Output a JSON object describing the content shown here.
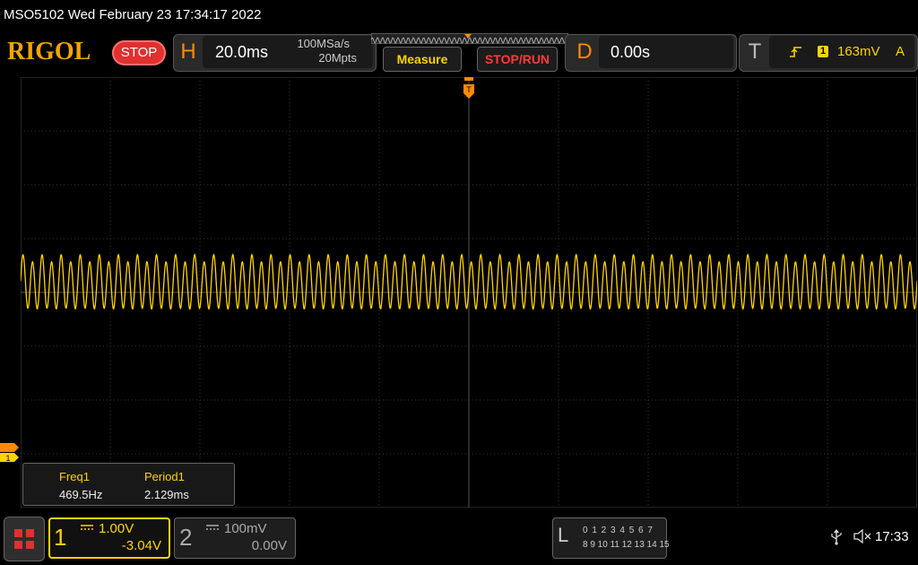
{
  "titlebar": {
    "text": "MSO5102  Wed February 23 17:34:17 2022"
  },
  "toolbar": {
    "logo": "RIGOL",
    "run_state": "STOP",
    "horizontal": {
      "letter": "H",
      "timebase": "20.0ms",
      "sample_rate": "100MSa/s",
      "memory_depth": "20Mpts"
    },
    "measure_label": "Measure",
    "stoprun_label": "STOP/RUN",
    "delay": {
      "letter": "D",
      "value": "0.00s"
    },
    "trigger": {
      "letter": "T",
      "edge_icon": "rising-edge-icon",
      "channel": "1",
      "level": "163mV",
      "mode": "A"
    }
  },
  "measurements": {
    "freq_label": "Freq1",
    "freq_value": "469.5Hz",
    "period_label": "Period1",
    "period_value": "2.129ms"
  },
  "channels": {
    "ch1": {
      "number": "1",
      "scale": "1.00V",
      "offset": "-3.04V",
      "color": "#ffd400"
    },
    "ch2": {
      "number": "2",
      "scale": "100mV",
      "offset": "0.00V",
      "color": "#aaaaaa"
    }
  },
  "logic": {
    "letter": "L",
    "row1": "0 1 2 3  4 5 6 7",
    "row2": "8 9 10 11 12 13 14 15"
  },
  "status": {
    "time": "17:33",
    "usb_icon": "usb-icon",
    "speaker_icon": "speaker-muted-icon"
  },
  "markers": {
    "trigger_pos_label": "T",
    "ch1_ground_label": "1"
  },
  "chart_data": {
    "type": "line",
    "series": [
      {
        "name": "1",
        "frequency_hz": 469.5,
        "period_ms": 2.129,
        "cycles_shown": 94
      }
    ],
    "x_scale_per_div": "20.0ms",
    "y_scale_per_div": "1.00V",
    "grid": true,
    "color": "#ffd400"
  }
}
